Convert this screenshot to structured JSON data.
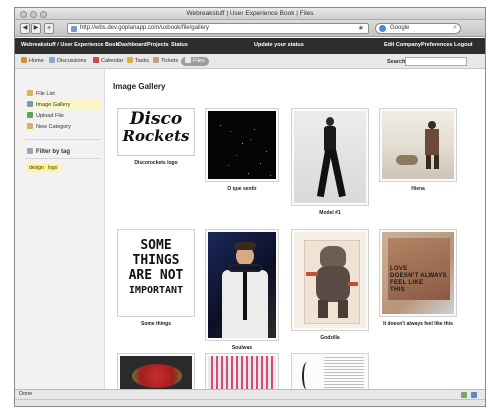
{
  "browser": {
    "window_title": "Webreakstuff | User Experience Book | Files",
    "back_label": "◀",
    "forward_label": "▶",
    "url": "http://wbs.dev.goplanapp.com/uxbook/file/gallery",
    "search_placeholder": "Google",
    "status": "Done"
  },
  "appnav": {
    "brand": "Webreakstuff / User Experience Book",
    "links": [
      "Dashboard",
      "Projects",
      "Status"
    ],
    "update_status": "Update your status",
    "right_links": [
      "Edit Company",
      "Preferences",
      "Logout"
    ]
  },
  "subnav": {
    "tabs": [
      "Home",
      "Discussions",
      "Calendar",
      "Tasks",
      "Tickets",
      "Files"
    ],
    "search_label": "Search:"
  },
  "sidebar": {
    "items": [
      "File List",
      "Image Gallery",
      "Upload File",
      "New Category"
    ],
    "filter_title": "Filter by tag",
    "tags": [
      "design",
      "logo"
    ]
  },
  "gallery": {
    "title": "Image Gallery",
    "items": [
      {
        "caption": "Discorockets logo",
        "art_line1": "Disco",
        "art_line2": "Rockets"
      },
      {
        "caption": "O que sentir"
      },
      {
        "caption": "Model #1"
      },
      {
        "caption": "Hiena"
      },
      {
        "caption": "Some things",
        "art_lines": [
          "SOME",
          "THINGS",
          "ARE NOT",
          "IMPORTANT"
        ]
      },
      {
        "caption": "Soulwax"
      },
      {
        "caption": "Godzilla"
      },
      {
        "caption": "It doesn't always feel like this",
        "art_lines": [
          "LOVE",
          "DOESN'T ALWAYS",
          "FEEL LIKE",
          "THIS"
        ]
      },
      {
        "caption": ""
      },
      {
        "caption": ""
      },
      {
        "caption": ""
      }
    ]
  },
  "colors": {
    "app_nav_bg": "#2d2d2d",
    "active_item_bg": "#fbf7c4",
    "tag_bg": "#fff38a"
  }
}
